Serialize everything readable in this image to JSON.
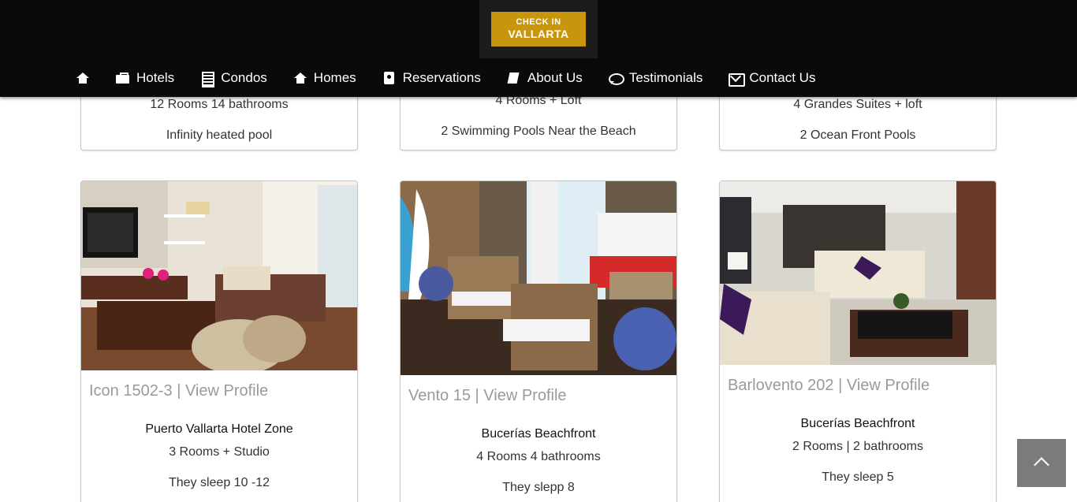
{
  "logo": {
    "line1": "CHECK IN",
    "line2": "VALLARTA"
  },
  "nav": {
    "home_icon": "home-icon",
    "items": [
      {
        "label": "Hotels",
        "icon": "suitcase-icon"
      },
      {
        "label": "Condos",
        "icon": "building-icon"
      },
      {
        "label": "Homes",
        "icon": "home-icon"
      },
      {
        "label": "Reservations",
        "icon": "contact-book-icon"
      },
      {
        "label": "About Us",
        "icon": "book-icon"
      },
      {
        "label": "Testimonials",
        "icon": "chat-icon"
      },
      {
        "label": "Contact Us",
        "icon": "envelope-icon"
      }
    ]
  },
  "top_cards": [
    {
      "line1": "12 Rooms 14 bathrooms",
      "line2": "Infinity heated pool"
    },
    {
      "line1": "4 Rooms + Loft",
      "line2": "2 Swimming Pools Near the Beach"
    },
    {
      "line1": "4 Grandes Suites + loft",
      "line2": "2 Ocean Front Pools"
    }
  ],
  "cards": [
    {
      "title": "Icon 1502-3 | View Profile",
      "location": "Puerto Vallarta Hotel Zone",
      "rooms": "3 Rooms + Studio",
      "sleeps": "They sleep 10 -12"
    },
    {
      "title": "Vento 15 | View Profile",
      "location": "Bucerías Beachfront",
      "rooms": "4 Rooms 4 bathrooms",
      "sleeps": "They slepp 8"
    },
    {
      "title": "Barlovento 202 | View Profile",
      "location": "Bucerías Beachfront",
      "rooms": "2 Rooms | 2 bathrooms",
      "sleeps": "They sleep 5"
    }
  ],
  "colors": {
    "header_bg": "#0a0a0a",
    "logo_gold": "#c8960c",
    "title_gray": "#9a9a9a",
    "scroll_btn": "#7b7b7b"
  },
  "scroll_top_icon": "chevron-up-icon"
}
